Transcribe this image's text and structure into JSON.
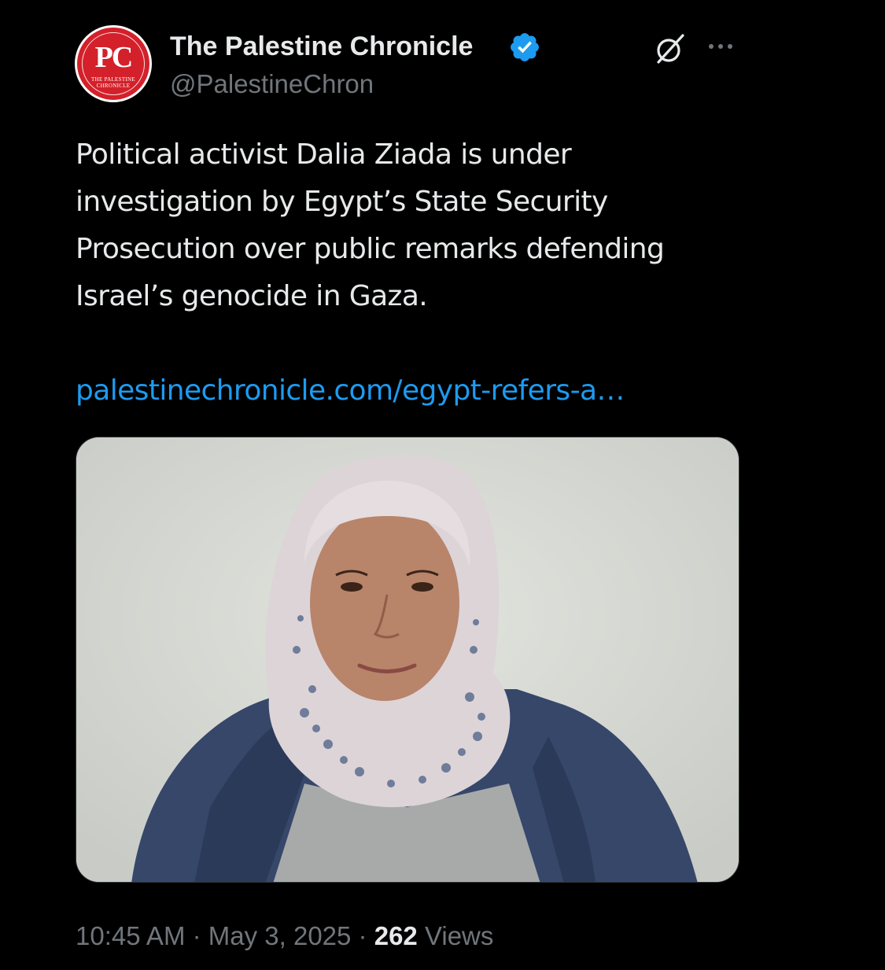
{
  "author": {
    "name": "The Palestine Chronicle",
    "handle": "@PalestineChron",
    "verified": true,
    "avatar_monogram": "PC",
    "avatar_subtitle_line1": "THE PALESTINE",
    "avatar_subtitle_line2": "CHRONICLE",
    "avatar_color": "#d4202a"
  },
  "icons": {
    "verified": "verified-badge-icon",
    "grok": "grok-icon",
    "more": "more-options-icon"
  },
  "tweet": {
    "text": "Political activist Dalia Ziada is under investigation by Egypt’s State Security Prosecution over public remarks defending Israel’s genocide in Gaza.",
    "link": "palestinechronicle.com/egypt-refers-a…"
  },
  "meta": {
    "time": "10:45 AM",
    "separator": " · ",
    "date": "May 3, 2025",
    "views_count": "262",
    "views_label": " Views"
  },
  "colors": {
    "background": "#000000",
    "text": "#e7e9ea",
    "secondary_text": "#71767b",
    "link": "#1d9bf0",
    "verified": "#1d9bf0"
  }
}
